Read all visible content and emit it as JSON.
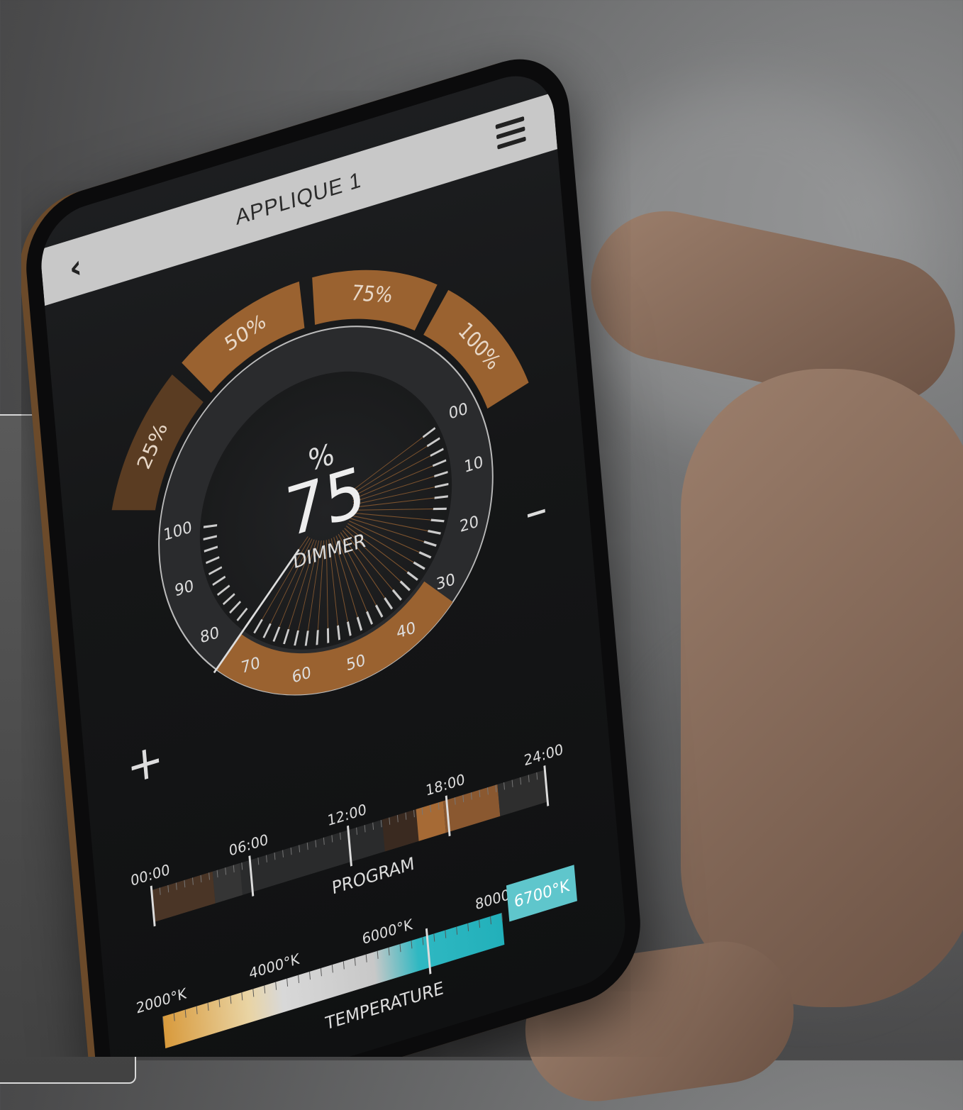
{
  "app": {
    "title": "APPLIQUE 1"
  },
  "presets": [
    {
      "label": "25%"
    },
    {
      "label": "50%"
    },
    {
      "label": "75%"
    },
    {
      "label": "100%"
    }
  ],
  "dimmer": {
    "unit": "%",
    "value": "75",
    "label": "DIMMER",
    "scale_labels": [
      "00",
      "10",
      "20",
      "30",
      "40",
      "50",
      "60",
      "70",
      "80",
      "90",
      "100"
    ],
    "level_percent": 75
  },
  "controls": {
    "plus": "+",
    "minus": "–"
  },
  "program": {
    "label": "PROGRAM",
    "times": [
      "00:00",
      "06:00",
      "12:00",
      "18:00",
      "24:00"
    ]
  },
  "temperature": {
    "label": "TEMPERATURE",
    "ticks": [
      "2000°K",
      "4000°K",
      "6000°K",
      "8000°K"
    ],
    "value": "6700°K"
  },
  "colors": {
    "accent": "#a66a35",
    "accent_light": "#c98a4a",
    "cyan": "#27b3bd",
    "topbar": "#c8c8c8"
  }
}
